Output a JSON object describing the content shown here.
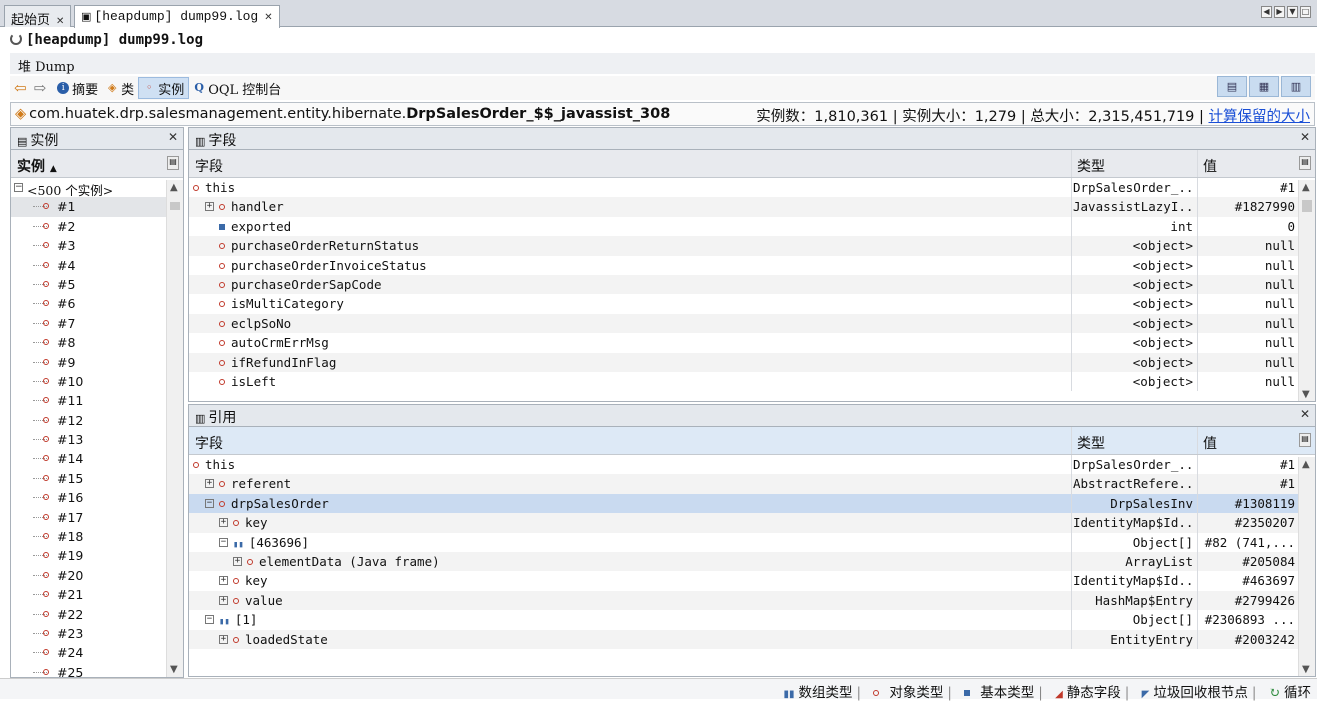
{
  "tabs": [
    {
      "label": "起始页"
    },
    {
      "label": "[heapdump] dump99.log"
    }
  ],
  "title": "[heapdump] dump99.log",
  "heap_header": "堆 Dump",
  "toolbar": {
    "summary": "摘要",
    "classes": "类",
    "instances": "实例",
    "oql": "OQL 控制台"
  },
  "classbar": {
    "prefix": "com.huatek.drp.salesmanagement.entity.hibernate.",
    "class_name": "DrpSalesOrder_$$_javassist_308",
    "stats": "实例数：1,810,361 | 实例大小：1,279 | 总大小：2,315,451,719 | ",
    "link": "计算保留的大小"
  },
  "instances_panel": {
    "title": "实例",
    "col": "实例",
    "root": "<500 个实例>",
    "items": [
      "#1",
      "#2",
      "#3",
      "#4",
      "#5",
      "#6",
      "#7",
      "#8",
      "#9",
      "#10",
      "#11",
      "#12",
      "#13",
      "#14",
      "#15",
      "#16",
      "#17",
      "#18",
      "#19",
      "#20",
      "#21",
      "#22",
      "#23",
      "#24",
      "#25"
    ]
  },
  "fields_panel": {
    "title": "字段",
    "cols": {
      "field": "字段",
      "type": "类型",
      "value": "值"
    },
    "rows": [
      {
        "name": "this",
        "type": "DrpSalesOrder_...",
        "value": "#1",
        "icon": "dot",
        "indent": 0,
        "exp": ""
      },
      {
        "name": "handler",
        "type": "JavassistLazyI...",
        "value": "#1827990",
        "icon": "dot",
        "indent": 1,
        "exp": "+"
      },
      {
        "name": "exported",
        "type": "int",
        "value": "0",
        "icon": "sq",
        "indent": 1,
        "exp": ""
      },
      {
        "name": "purchaseOrderReturnStatus",
        "type": "<object>",
        "value": "null",
        "icon": "dot",
        "indent": 1,
        "exp": ""
      },
      {
        "name": "purchaseOrderInvoiceStatus",
        "type": "<object>",
        "value": "null",
        "icon": "dot",
        "indent": 1,
        "exp": ""
      },
      {
        "name": "purchaseOrderSapCode",
        "type": "<object>",
        "value": "null",
        "icon": "dot",
        "indent": 1,
        "exp": ""
      },
      {
        "name": "isMultiCategory",
        "type": "<object>",
        "value": "null",
        "icon": "dot",
        "indent": 1,
        "exp": ""
      },
      {
        "name": "eclpSoNo",
        "type": "<object>",
        "value": "null",
        "icon": "dot",
        "indent": 1,
        "exp": ""
      },
      {
        "name": "autoCrmErrMsg",
        "type": "<object>",
        "value": "null",
        "icon": "dot",
        "indent": 1,
        "exp": ""
      },
      {
        "name": "ifRefundInFlag",
        "type": "<object>",
        "value": "null",
        "icon": "dot",
        "indent": 1,
        "exp": ""
      },
      {
        "name": "isLeft",
        "type": "<object>",
        "value": "null",
        "icon": "dot",
        "indent": 1,
        "exp": ""
      }
    ]
  },
  "refs_panel": {
    "title": "引用",
    "cols": {
      "field": "字段",
      "type": "类型",
      "value": "值"
    },
    "rows": [
      {
        "name": "this",
        "type": "DrpSalesOrder_...",
        "value": "#1",
        "icon": "dot",
        "indent": 0,
        "exp": ""
      },
      {
        "name": "referent",
        "type": "AbstractRefere...",
        "value": "#1",
        "icon": "dot",
        "indent": 1,
        "exp": "+"
      },
      {
        "name": "drpSalesOrder",
        "type": "DrpSalesInv",
        "value": "#1308119",
        "icon": "dot",
        "indent": 1,
        "exp": "-",
        "sel": true
      },
      {
        "name": "key",
        "type": "IdentityMap$Id...",
        "value": "#2350207",
        "icon": "dot",
        "indent": 2,
        "exp": "+"
      },
      {
        "name": "[463696]",
        "type": "Object[]",
        "value": "#82  (741,...",
        "icon": "arr",
        "indent": 2,
        "exp": "-"
      },
      {
        "name": "elementData (Java frame)",
        "type": "ArrayList",
        "value": "#205084",
        "icon": "dot",
        "indent": 3,
        "exp": "+"
      },
      {
        "name": "key",
        "type": "IdentityMap$Id...",
        "value": "#463697",
        "icon": "dot",
        "indent": 2,
        "exp": "+"
      },
      {
        "name": "value",
        "type": "HashMap$Entry",
        "value": "#2799426",
        "icon": "dot",
        "indent": 2,
        "exp": "+"
      },
      {
        "name": "[1]",
        "type": "Object[]",
        "value": "#2306893 ...",
        "icon": "arr",
        "indent": 1,
        "exp": "-"
      },
      {
        "name": "loadedState",
        "type": "EntityEntry",
        "value": "#2003242",
        "icon": "dot",
        "indent": 2,
        "exp": "+"
      }
    ]
  },
  "status": [
    "数组类型",
    "对象类型",
    "基本类型",
    "静态字段",
    "垃圾回收根节点",
    "循环"
  ]
}
